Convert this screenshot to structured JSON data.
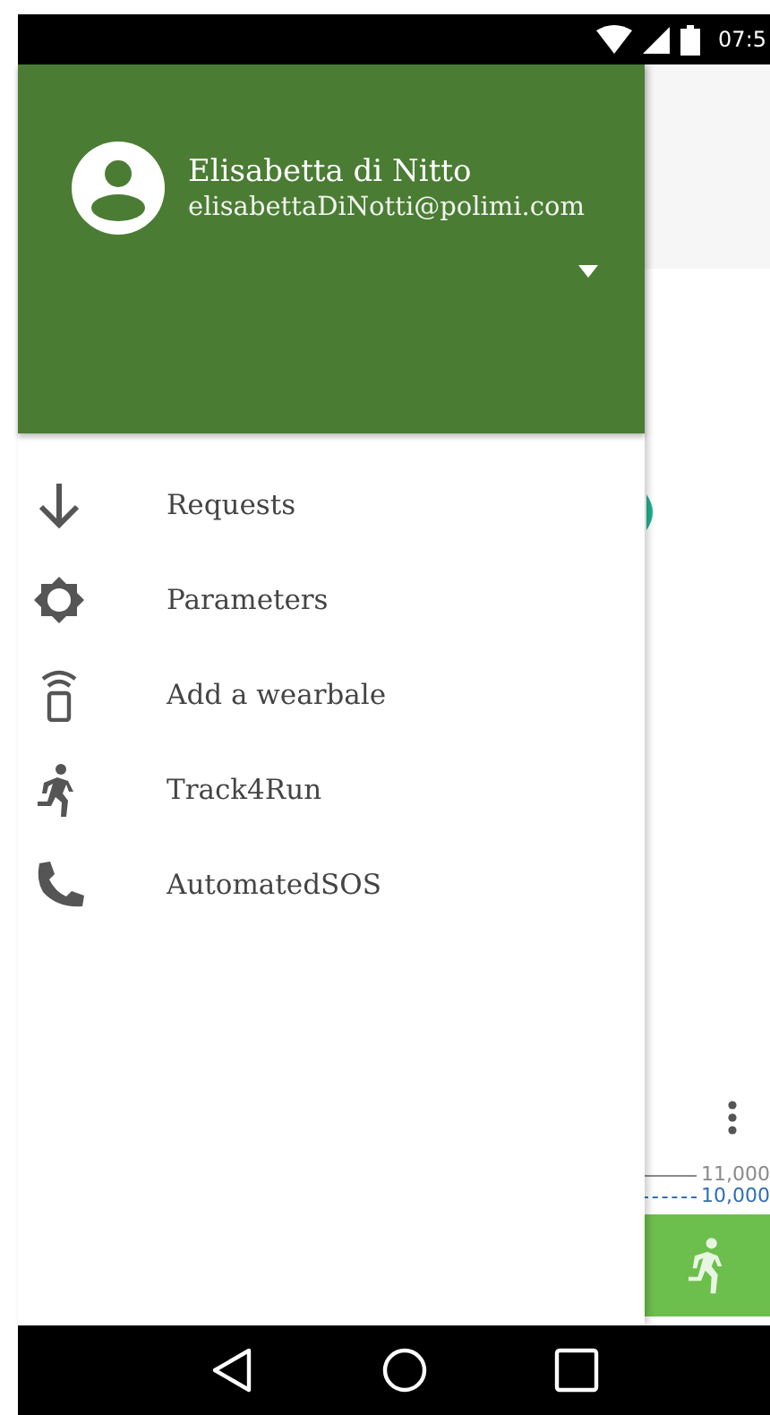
{
  "status_bar": {
    "time": "07:5"
  },
  "drawer": {
    "header": {
      "name": "Elisabetta di Nitto",
      "email": "elisabettaDiNotti@polimi.com"
    },
    "items": [
      {
        "label": "Requests"
      },
      {
        "label": "Parameters"
      },
      {
        "label": "Add a wearbale"
      },
      {
        "label": "Track4Run"
      },
      {
        "label": "AutomatedSOS"
      }
    ]
  },
  "background": {
    "legend": [
      {
        "label": "11,000",
        "color": "#8a8a8a"
      },
      {
        "label": "10,000",
        "color": "#2f6fb3"
      }
    ]
  }
}
